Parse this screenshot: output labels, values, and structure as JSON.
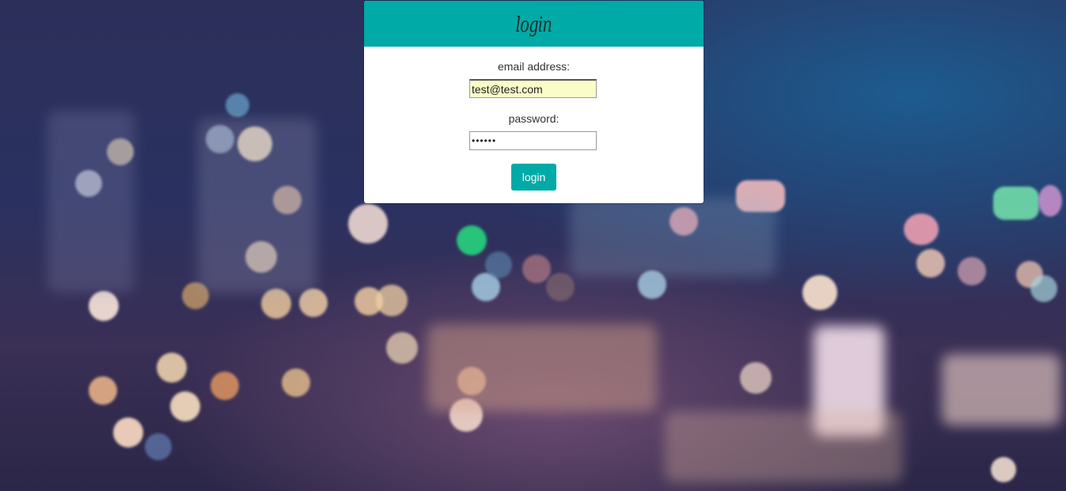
{
  "login_card": {
    "title": "login",
    "email_label": "email address:",
    "email_value": "test@test.com",
    "password_label": "password:",
    "password_value": "123456",
    "login_button_label": "login"
  },
  "colors": {
    "accent": "#00aaa6",
    "autofill_background": "#fafdc8"
  }
}
